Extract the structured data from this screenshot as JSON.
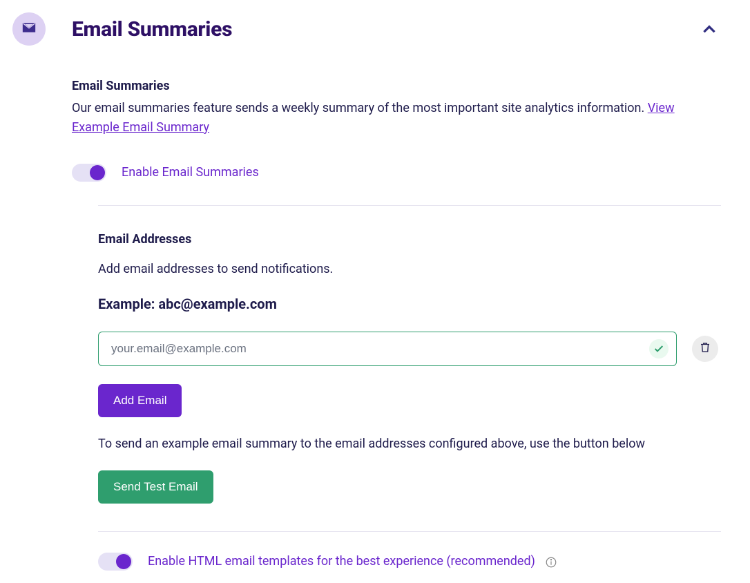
{
  "header": {
    "title": "Email Summaries"
  },
  "intro": {
    "heading": "Email Summaries",
    "description": "Our email summaries feature sends a weekly summary of the most important site analytics information.",
    "link_text": "View Example Email Summary"
  },
  "toggle_enable": {
    "label": "Enable Email Summaries"
  },
  "addresses": {
    "heading": "Email Addresses",
    "description": "Add email addresses to send notifications.",
    "example_label": "Example: abc@example.com",
    "input_placeholder": "your.email@example.com",
    "add_button": "Add Email",
    "test_description": "To send an example email summary to the email addresses configured above, use the button below",
    "send_test_button": "Send Test Email"
  },
  "toggle_html": {
    "label": "Enable HTML email templates for the best experience (recommended)"
  }
}
